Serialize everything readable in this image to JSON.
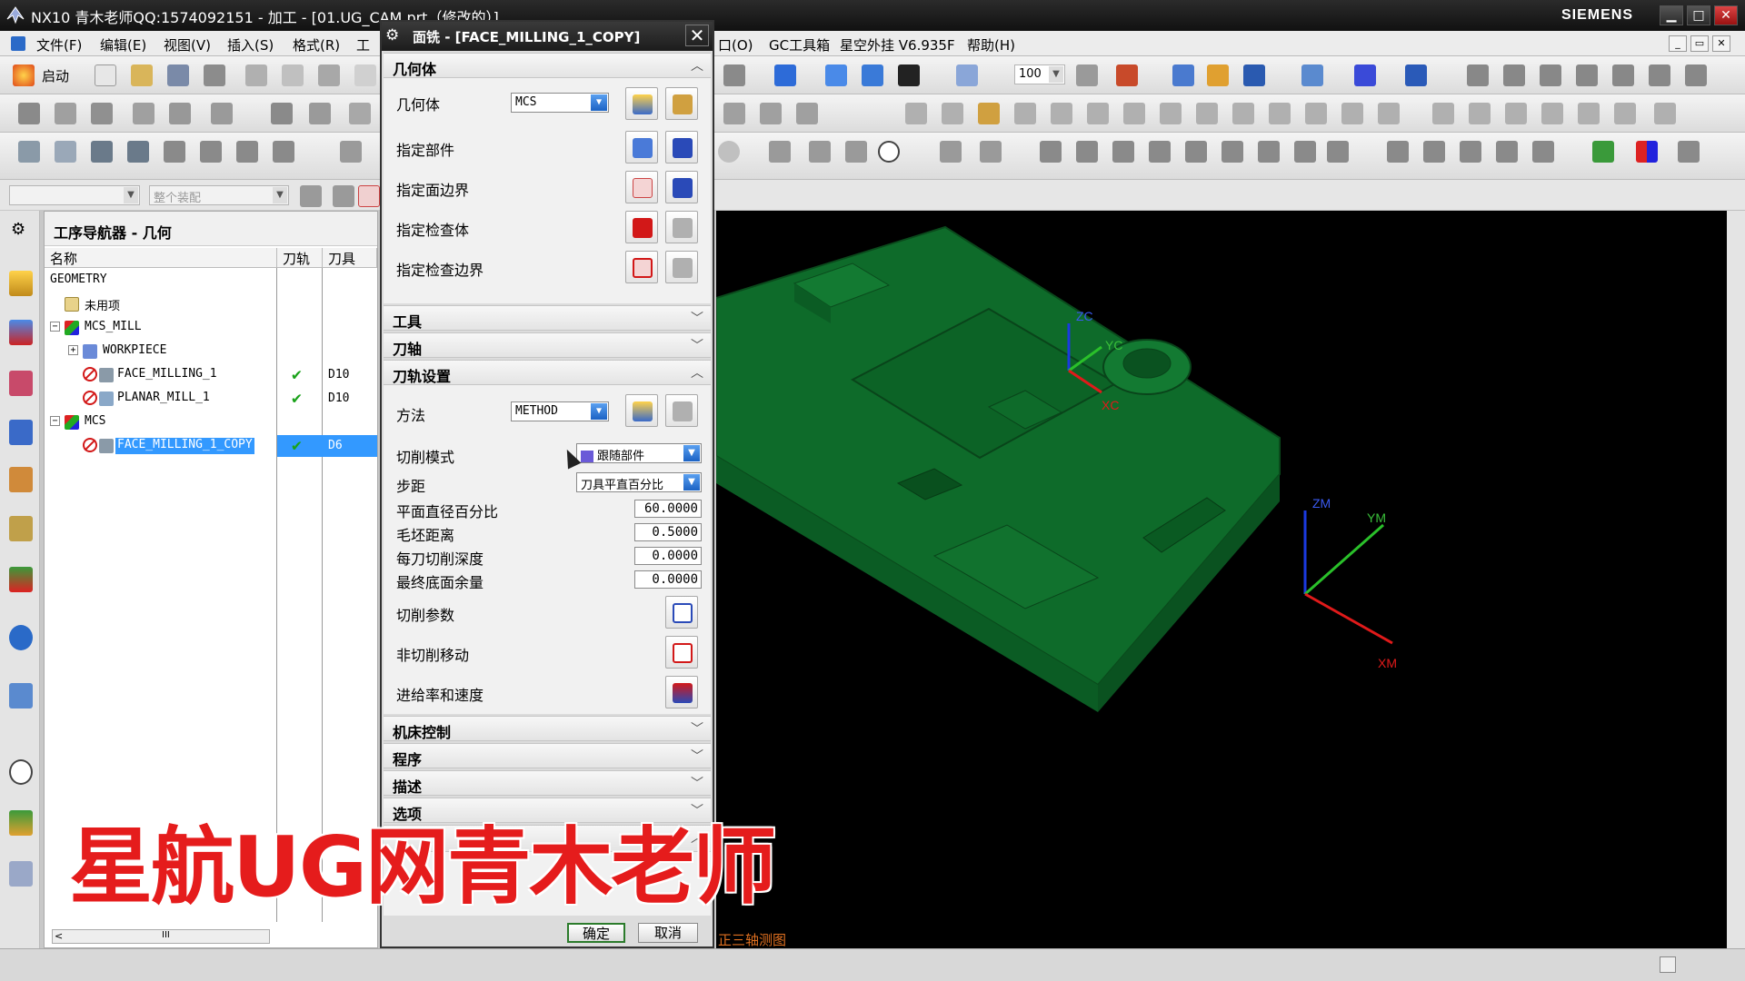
{
  "window": {
    "title": "NX10 青木老师QQ:1574092151 - 加工 - [01.UG_CAM.prt（修改的）]",
    "brand": "SIEMENS",
    "controls": {
      "minimize": "▁",
      "maximize": "□",
      "close": "✕"
    }
  },
  "menu": {
    "items": [
      "文件(F)",
      "编辑(E)",
      "视图(V)",
      "插入(S)",
      "格式(R)",
      "工"
    ],
    "right_items": [
      "口(O)",
      "GC工具箱",
      "星空外挂 V6.935F",
      "帮助(H)"
    ]
  },
  "toolbar": {
    "start_label": "启动",
    "zoom_value": "100",
    "select_filter": "",
    "assembly_scope": "整个装配"
  },
  "navigator": {
    "title": "工序导航器 - 几何",
    "columns": [
      "名称",
      "刀轨",
      "刀具"
    ],
    "rows": [
      {
        "name": "GEOMETRY",
        "tool": "",
        "path_ok": false
      },
      {
        "name": "未用项",
        "tool": "",
        "path_ok": false
      },
      {
        "name": "MCS_MILL",
        "tool": "",
        "path_ok": false
      },
      {
        "name": "WORKPIECE",
        "tool": "",
        "path_ok": false
      },
      {
        "name": "FACE_MILLING_1",
        "tool": "D10",
        "path_ok": true
      },
      {
        "name": "PLANAR_MILL_1",
        "tool": "D10",
        "path_ok": true
      },
      {
        "name": "MCS",
        "tool": "",
        "path_ok": false
      },
      {
        "name": "FACE_MILLING_1_COPY",
        "tool": "D6",
        "path_ok": true
      }
    ],
    "scroll_mark": "III",
    "scroll_left": "<"
  },
  "dialog": {
    "title": "面铣 - [FACE_MILLING_1_COPY]",
    "sections": {
      "geometry": "几何体",
      "tool": "工具",
      "axis": "刀轴",
      "path_settings": "刀轨设置",
      "machine_control": "机床控制",
      "program": "程序",
      "description": "描述",
      "options": "选项"
    },
    "geometry_rows": {
      "geometry_label": "几何体",
      "geometry_value": "MCS",
      "specify_part": "指定部件",
      "specify_face_boundary": "指定面边界",
      "specify_check_body": "指定检查体",
      "specify_check_boundary": "指定检查边界"
    },
    "path": {
      "method_label": "方法",
      "method_value": "METHOD",
      "cut_pattern_label": "切削模式",
      "cut_pattern_value": "跟随部件",
      "stepover_label": "步距",
      "stepover_value": "刀具平直百分比",
      "flat_diameter_pct_label": "平面直径百分比",
      "flat_diameter_pct_value": "60.0000",
      "blank_distance_label": "毛坯距离",
      "blank_distance_value": "0.5000",
      "depth_per_cut_label": "每刀切削深度",
      "depth_per_cut_value": "0.0000",
      "final_floor_stock_label": "最终底面余量",
      "final_floor_stock_value": "0.0000",
      "cutting_params_label": "切削参数",
      "non_cutting_label": "非切削移动",
      "feeds_speeds_label": "进给率和速度"
    },
    "ok_label": "确定",
    "cancel_label": "取消"
  },
  "graphics": {
    "view_name": "正三轴测图",
    "axis_labels": {
      "wcs_z": "ZC",
      "wcs_y": "YC",
      "wcs_x": "XC",
      "mcs_z": "ZM",
      "mcs_y": "YM",
      "mcs_x": "XM"
    },
    "part_color": "#0e6b2a"
  },
  "watermark": "星航UG网青木老师",
  "colors": {
    "selection": "#3399ff",
    "check": "#1aa21a",
    "error": "#d21818",
    "view_label": "#e07020"
  }
}
